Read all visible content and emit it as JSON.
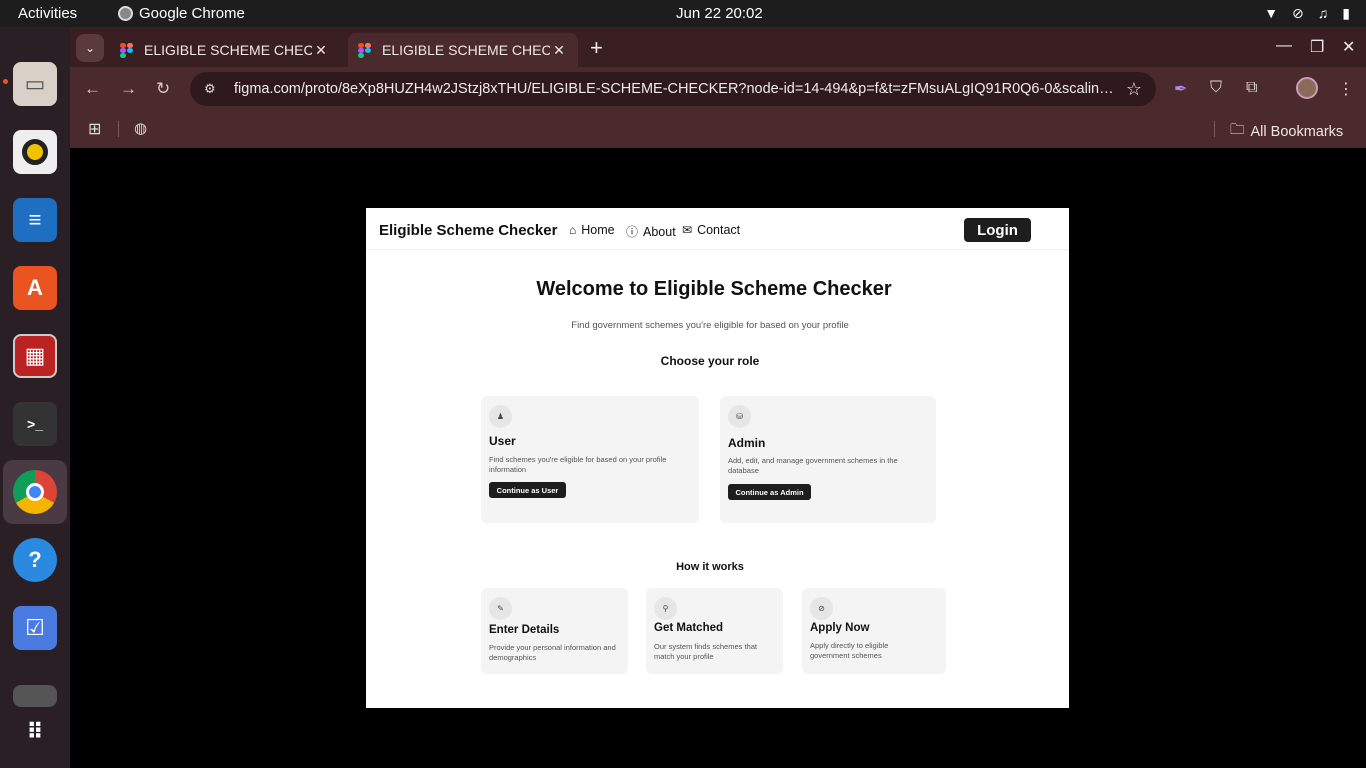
{
  "topbar": {
    "activities": "Activities",
    "app_name": "Google Chrome",
    "clock": "Jun 22  20:02"
  },
  "browser": {
    "tabs": [
      {
        "title": "ELIGIBLE SCHEME CHECKER"
      },
      {
        "title": "ELIGIBLE SCHEME CHECKER"
      }
    ],
    "url": "figma.com/proto/8eXp8HUZH4w2JStzj8xTHU/ELIGIBLE-SCHEME-CHECKER?node-id=14-494&p=f&t=zFMsuALgIQ91R0Q6-0&scaling=scale...",
    "all_bookmarks": "All Bookmarks"
  },
  "site": {
    "brand": "Eligible Scheme Checker",
    "nav": {
      "home": "Home",
      "about": "About",
      "contact": "Contact"
    },
    "login": "Login",
    "heading": "Welcome to Eligible Scheme Checker",
    "subheading": "Find government schemes you're eligible for based on your profile",
    "choose_role": "Choose your role",
    "roles": {
      "user": {
        "title": "User",
        "description": "Find schemes you're eligible for based on your profile information",
        "button": "Continue as User"
      },
      "admin": {
        "title": "Admin",
        "description": "Add, edit, and manage government schemes in the database",
        "button": "Continue as Admin"
      }
    },
    "how_it_works": "How it works",
    "steps": [
      {
        "title": "Enter Details",
        "description": "Provide your personal information and demographics"
      },
      {
        "title": "Get Matched",
        "description": "Our system finds schemes that match your profile"
      },
      {
        "title": "Apply Now",
        "description": "Apply directly to eligible government schemes"
      }
    ]
  },
  "colors": {
    "desktop_bg": "#000000",
    "dock_bg": "#2b1f26",
    "chrome_frame": "#4a2a2c",
    "ubuntu_accent": "#e95420",
    "button_dark": "#1e1e1e",
    "card_bg": "#f4f4f4"
  }
}
